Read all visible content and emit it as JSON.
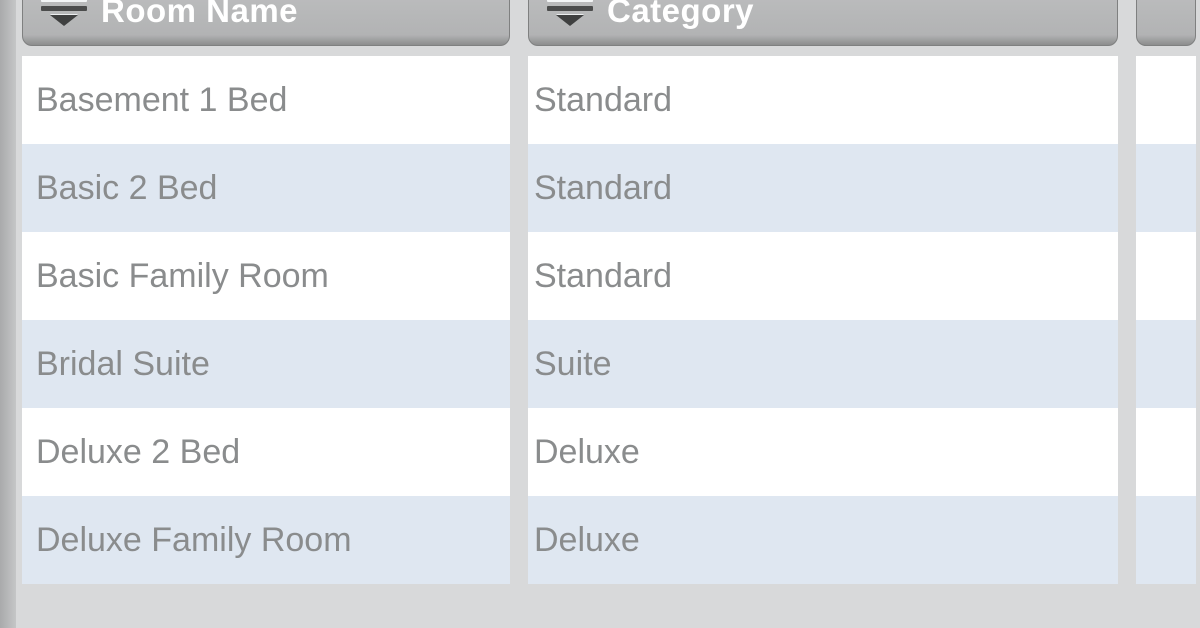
{
  "table": {
    "columns": [
      {
        "key": "room_name",
        "label": "Room Name"
      },
      {
        "key": "category",
        "label": "Category"
      },
      {
        "key": "extra",
        "label": ""
      }
    ],
    "rows": [
      {
        "room_name": "Basement 1 Bed",
        "category": "Standard"
      },
      {
        "room_name": "Basic 2 Bed",
        "category": "Standard"
      },
      {
        "room_name": "Basic Family Room",
        "category": "Standard"
      },
      {
        "room_name": "Bridal Suite",
        "category": "Suite"
      },
      {
        "room_name": "Deluxe 2 Bed",
        "category": "Deluxe"
      },
      {
        "room_name": "Deluxe Family Room",
        "category": "Deluxe"
      }
    ]
  }
}
